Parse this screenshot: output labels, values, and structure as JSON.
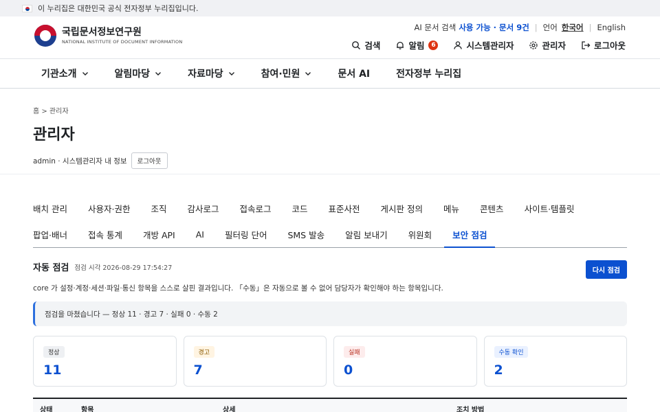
{
  "gov_banner": "이 누리집은 대한민국 공식 전자정부 누리집입니다.",
  "logo": {
    "ko": "국립문서정보연구원",
    "en": "NATIONAL INSTITUTE OF DOCUMENT INFORMATION"
  },
  "util_top": {
    "ai_label": "AI 문서 검색",
    "ai_status": "사용 가능 · 문서 9건",
    "lang_label": "언어",
    "lang_ko": "한국어",
    "lang_en": "English"
  },
  "util_bottom": {
    "search": "검색",
    "alert": "알림",
    "alert_count": "6",
    "sysadmin": "시스템관리자",
    "admin": "관리자",
    "logout": "로그아웃"
  },
  "gnb": [
    "기관소개",
    "알림마당",
    "자료마당",
    "참여·민원",
    "문서 AI",
    "전자정부 누리집"
  ],
  "breadcrumb": "홈 > 관리자",
  "page_title": "관리자",
  "user_line": "admin · 시스템관리자 내 정보",
  "user_logout": "로그아웃",
  "tabs_row1": [
    "배치 관리",
    "사용자·권한",
    "조직",
    "감사로그",
    "접속로그",
    "코드",
    "표준사전",
    "게시판 정의",
    "메뉴",
    "콘텐츠",
    "사이트·템플릿"
  ],
  "tabs_row2": [
    "팝업·배너",
    "접속 통계",
    "개방 API",
    "AI",
    "필터링 단어",
    "SMS 발송",
    "알림 보내기",
    "위원회",
    "보안 점검"
  ],
  "active_tab": "보안 점검",
  "section": {
    "title": "자동 점검",
    "time": "점검 시각 2026-08-29 17:54:27",
    "rerun": "다시 점검",
    "desc": "core 가 설정·계정·세션·파일·통신 항목을 스스로 살핀 결과입니다. 「수동」은 자동으로 볼 수 없어 담당자가 확인해야 하는 항목입니다.",
    "notice": "점검을 마쳤습니다 — 정상 11 · 경고 7 · 실패 0 · 수동 2"
  },
  "cards": [
    {
      "label": "정상",
      "value": "11",
      "kind": "ok"
    },
    {
      "label": "경고",
      "value": "7",
      "kind": "warn"
    },
    {
      "label": "실패",
      "value": "0",
      "kind": "fail"
    },
    {
      "label": "수동 확인",
      "value": "2",
      "kind": "manual"
    }
  ],
  "table_headers": [
    "상태",
    "항목",
    "상세",
    "조치 방법"
  ],
  "colors": {
    "primary": "#0b50d0",
    "badge": "#de3412",
    "accent_border": "#2c6fde"
  }
}
